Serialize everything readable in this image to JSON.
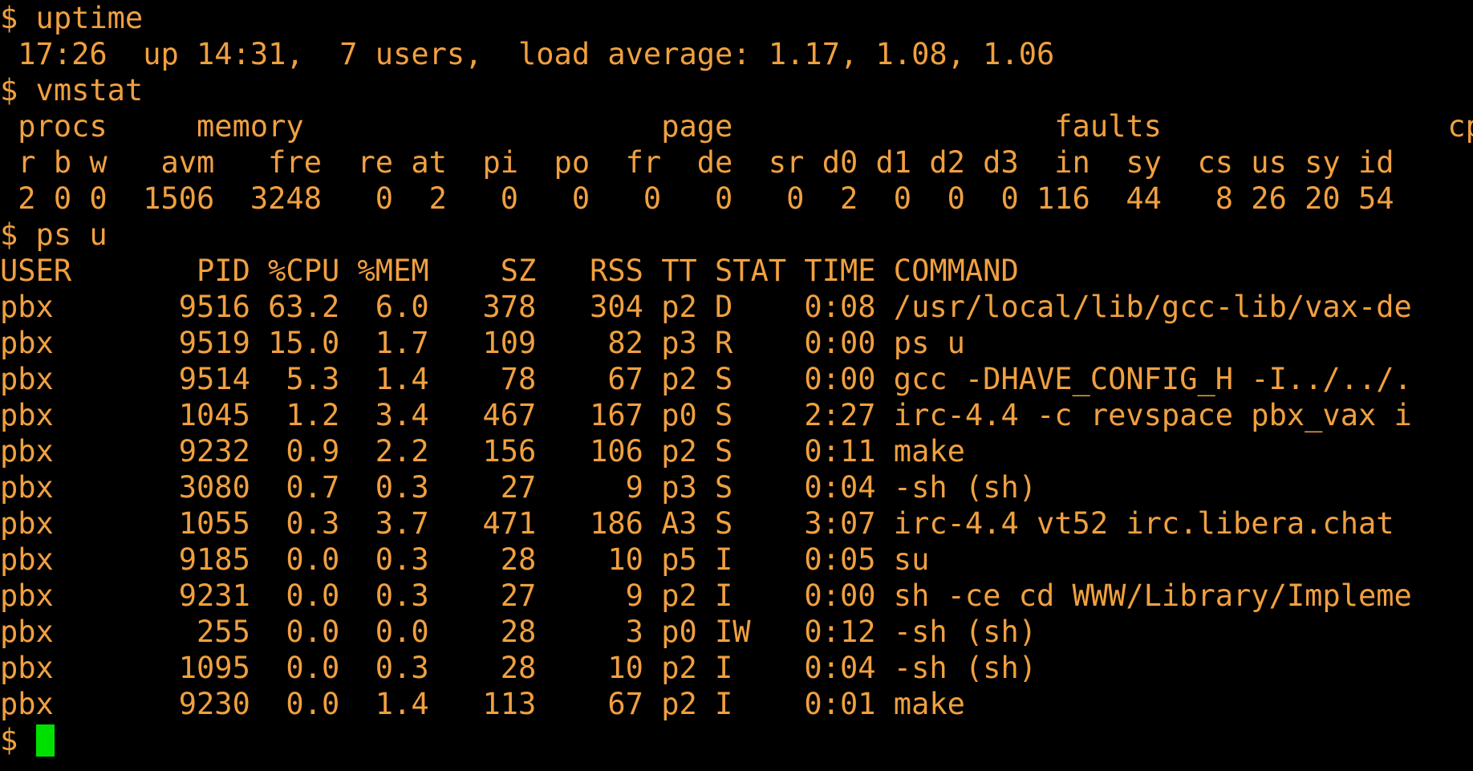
{
  "terminal": {
    "fg_color": "#F0A040",
    "bg_color": "#000000",
    "cursor_color": "#00E000",
    "lines": [
      "$ uptime",
      " 17:26  up 14:31,  7 users,  load average: 1.17, 1.08, 1.06",
      "$ vmstat",
      " procs     memory                    page                  faults                cpu",
      " r b w   avm   fre  re at  pi  po  fr  de  sr d0 d1 d2 d3  in  sy  cs us sy id",
      " 2 0 0  1506  3248   0  2   0   0   0   0   0  2  0  0  0 116  44   8 26 20 54",
      "$ ps u",
      "USER       PID %CPU %MEM    SZ   RSS TT STAT TIME COMMAND",
      "pbx       9516 63.2  6.0   378   304 p2 D    0:08 /usr/local/lib/gcc-lib/vax-de",
      "pbx       9519 15.0  1.7   109    82 p3 R    0:00 ps u",
      "pbx       9514  5.3  1.4    78    67 p2 S    0:00 gcc -DHAVE_CONFIG_H -I../../.",
      "pbx       1045  1.2  3.4   467   167 p0 S    2:27 irc-4.4 -c revspace pbx_vax i",
      "pbx       9232  0.9  2.2   156   106 p2 S    0:11 make",
      "pbx       3080  0.7  0.3    27     9 p3 S    0:04 -sh (sh)",
      "pbx       1055  0.3  3.7   471   186 A3 S    3:07 irc-4.4 vt52 irc.libera.chat",
      "pbx       9185  0.0  0.3    28    10 p5 I    0:05 su",
      "pbx       9231  0.0  0.3    27     9 p2 I    0:00 sh -ce cd WWW/Library/Impleme",
      "pbx        255  0.0  0.0    28     3 p0 IW   0:12 -sh (sh)",
      "pbx       1095  0.0  0.3    28    10 p2 I    0:04 -sh (sh)",
      "pbx       9230  0.0  1.4   113    67 p2 I    0:01 make"
    ],
    "prompt": "$"
  }
}
